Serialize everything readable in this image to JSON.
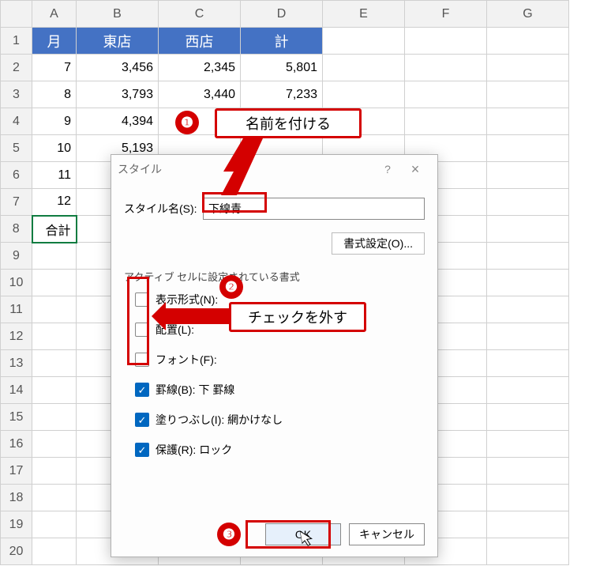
{
  "grid": {
    "cols": [
      "A",
      "B",
      "C",
      "D",
      "E",
      "F",
      "G"
    ],
    "rowcount": 20,
    "header": {
      "A": "月",
      "B": "東店",
      "C": "西店",
      "D": "計"
    },
    "rows": [
      {
        "A": "7",
        "B": "3,456",
        "C": "2,345",
        "D": "5,801"
      },
      {
        "A": "8",
        "B": "3,793",
        "C": "3,440",
        "D": "7,233"
      },
      {
        "A": "9",
        "B": "4,394"
      },
      {
        "A": "10",
        "B": "5,193"
      },
      {
        "A": "11"
      },
      {
        "A": "12"
      }
    ],
    "total_label": "合計"
  },
  "dialog": {
    "title": "スタイル",
    "help": "?",
    "close": "×",
    "style_name_label": "スタイル名(S):",
    "style_name_value": "下線青",
    "format_button": "書式設定(O)...",
    "section": "アクティブ セルに設定されている書式",
    "chk_number": "表示形式(N):",
    "chk_align": "配置(L):",
    "chk_font": "フォント(F):",
    "chk_border": "罫線(B): 下 罫線",
    "chk_fill": "塗りつぶし(I): 網かけなし",
    "chk_protect": "保護(R): ロック",
    "ok": "OK",
    "cancel": "キャンセル"
  },
  "annotations": {
    "a1": "名前を付ける",
    "a2": "チェックを外す"
  }
}
